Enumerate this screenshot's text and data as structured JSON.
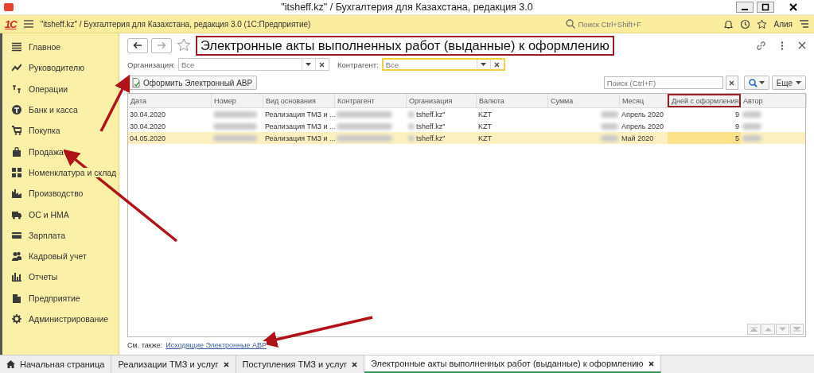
{
  "window": {
    "title": "\"itsheff.kz\" / Бухгалтерия для Казахстана, редакция 3.0"
  },
  "toolbar": {
    "logo": "1С",
    "path": "\"itsheff.kz\" / Бухгалтерия для Казахстана, редакция 3.0  (1С:Предприятие)",
    "search": {
      "placeholder": "Поиск Ctrl+Shift+F"
    },
    "user": "Алия"
  },
  "sidebar": {
    "items": [
      {
        "label": "Главное",
        "selected": false
      },
      {
        "label": "Руководителю",
        "selected": false
      },
      {
        "label": "Операции",
        "selected": false
      },
      {
        "label": "Банк и касса",
        "selected": false
      },
      {
        "label": "Покупка",
        "selected": false
      },
      {
        "label": "Продажа",
        "selected": false
      },
      {
        "label": "Номенклатура и склад",
        "selected": false
      },
      {
        "label": "Производство",
        "selected": false
      },
      {
        "label": "ОС и НМА",
        "selected": false
      },
      {
        "label": "Зарплата",
        "selected": false
      },
      {
        "label": "Кадровый учет",
        "selected": false
      },
      {
        "label": "Отчеты",
        "selected": false
      },
      {
        "label": "Предприятие",
        "selected": false
      },
      {
        "label": "Администрирование",
        "selected": false
      }
    ]
  },
  "form": {
    "title": "Электронные акты выполненных работ (выданные) к оформлению",
    "filters": [
      {
        "label": "Организация:",
        "placeholder": "Все",
        "focused": false
      },
      {
        "label": "Контрагент:",
        "placeholder": "Все",
        "focused": true
      }
    ],
    "action_button": "Оформить Электронный АВР",
    "search": {
      "placeholder": "Поиск (Ctrl+F)"
    },
    "more_button": "Еще",
    "table": {
      "columns": [
        {
          "label": "Дата",
          "highlighted": false
        },
        {
          "label": "Номер",
          "highlighted": false
        },
        {
          "label": "Вид основания",
          "highlighted": false
        },
        {
          "label": "Контрагент",
          "highlighted": false
        },
        {
          "label": "Организация",
          "highlighted": false
        },
        {
          "label": "Валюта",
          "highlighted": false
        },
        {
          "label": "Сумма",
          "highlighted": false
        },
        {
          "label": "Месяц",
          "highlighted": false
        },
        {
          "label": "Дней с оформления",
          "highlighted": true
        },
        {
          "label": "Автор",
          "highlighted": false
        }
      ],
      "rows": [
        {
          "date": "30.04.2020",
          "basis": "Реализация ТМЗ и ...",
          "organization": "tsheff.kz\"",
          "currency": "KZT",
          "month": "Апрель 2020",
          "days": "9",
          "selected": false
        },
        {
          "date": "30.04.2020",
          "basis": "Реализация ТМЗ и ...",
          "organization": "tsheff.kz\"",
          "currency": "KZT",
          "month": "Апрель 2020",
          "days": "9",
          "selected": false
        },
        {
          "date": "04.05.2020",
          "basis": "Реализация ТМЗ и ...",
          "organization": "tsheff.kz\"",
          "currency": "KZT",
          "month": "Май 2020",
          "days": "5",
          "selected": true
        }
      ]
    },
    "see_also": {
      "label": "См. также:",
      "link": "Исходящие Электронные АВР"
    }
  },
  "tabs": [
    {
      "label": "Начальная страница",
      "kind": "home",
      "selected": false
    },
    {
      "label": "Реализации ТМЗ и услуг",
      "kind": "document",
      "selected": false
    },
    {
      "label": "Поступления ТМЗ и услуг",
      "kind": "document",
      "selected": false
    },
    {
      "label": "Электронные акты выполненных работ (выданные) к оформлению",
      "kind": "document",
      "selected": true
    }
  ]
}
